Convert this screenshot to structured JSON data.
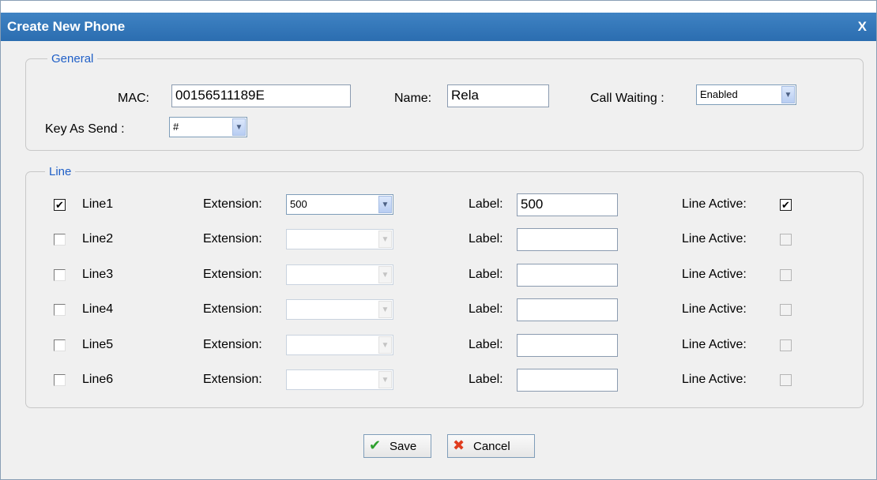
{
  "dialog": {
    "title": "Create New Phone",
    "close": "X"
  },
  "general": {
    "legend": "General",
    "mac_label": "MAC:",
    "mac_value": "00156511189E",
    "name_label": "Name:",
    "name_value": "Rela",
    "call_waiting_label": "Call Waiting :",
    "call_waiting_value": "Enabled",
    "key_as_send_label": "Key As Send :",
    "key_as_send_value": "#"
  },
  "line": {
    "legend": "Line",
    "extension_label": "Extension:",
    "label_label": "Label:",
    "line_active_label": "Line Active:",
    "rows": [
      {
        "name": "Line1",
        "checked": true,
        "extension": "500",
        "label": "500",
        "active": true
      },
      {
        "name": "Line2",
        "checked": false,
        "extension": "",
        "label": "",
        "active": false
      },
      {
        "name": "Line3",
        "checked": false,
        "extension": "",
        "label": "",
        "active": false
      },
      {
        "name": "Line4",
        "checked": false,
        "extension": "",
        "label": "",
        "active": false
      },
      {
        "name": "Line5",
        "checked": false,
        "extension": "",
        "label": "",
        "active": false
      },
      {
        "name": "Line6",
        "checked": false,
        "extension": "",
        "label": "",
        "active": false
      }
    ]
  },
  "buttons": {
    "save": "Save",
    "cancel": "Cancel"
  },
  "colors": {
    "titlebar": "#2f74b8",
    "legend": "#1f5fc7",
    "save_icon": "#2ea02e",
    "cancel_icon": "#e03c1e"
  }
}
